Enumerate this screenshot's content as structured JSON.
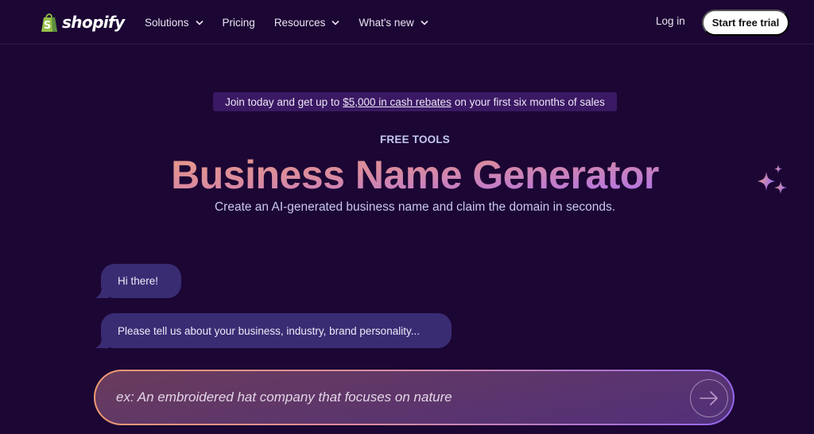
{
  "header": {
    "brand": "shopify",
    "nav": [
      {
        "label": "Solutions",
        "has_dropdown": true
      },
      {
        "label": "Pricing",
        "has_dropdown": false
      },
      {
        "label": "Resources",
        "has_dropdown": true
      },
      {
        "label": "What's new",
        "has_dropdown": true
      }
    ],
    "login_label": "Log in",
    "cta_label": "Start free trial"
  },
  "promo": {
    "prefix": "Join today and get up to",
    "link_text": "$5,000 in cash rebates",
    "suffix": "on your first six months of sales"
  },
  "hero": {
    "eyebrow": "FREE TOOLS",
    "title": "Business Name Generator",
    "subtitle": "Create an AI-generated business name and claim the domain in seconds.",
    "decor_icon": "sparkles-icon"
  },
  "chat": {
    "messages": [
      {
        "text": "Hi there!"
      },
      {
        "text": "Please tell us about your business, industry, brand personality..."
      }
    ],
    "input": {
      "value": "",
      "placeholder": "ex: An embroidered hat company that focuses on nature",
      "submit_icon": "arrow-right-icon"
    }
  },
  "colors": {
    "background": "#1c0634",
    "promo_bg": "#3a1863",
    "bubble_bg": "#392c73",
    "gradient_start": "#f0a07a",
    "gradient_end": "#9b6cf0",
    "logo_green": "#95bf47"
  }
}
